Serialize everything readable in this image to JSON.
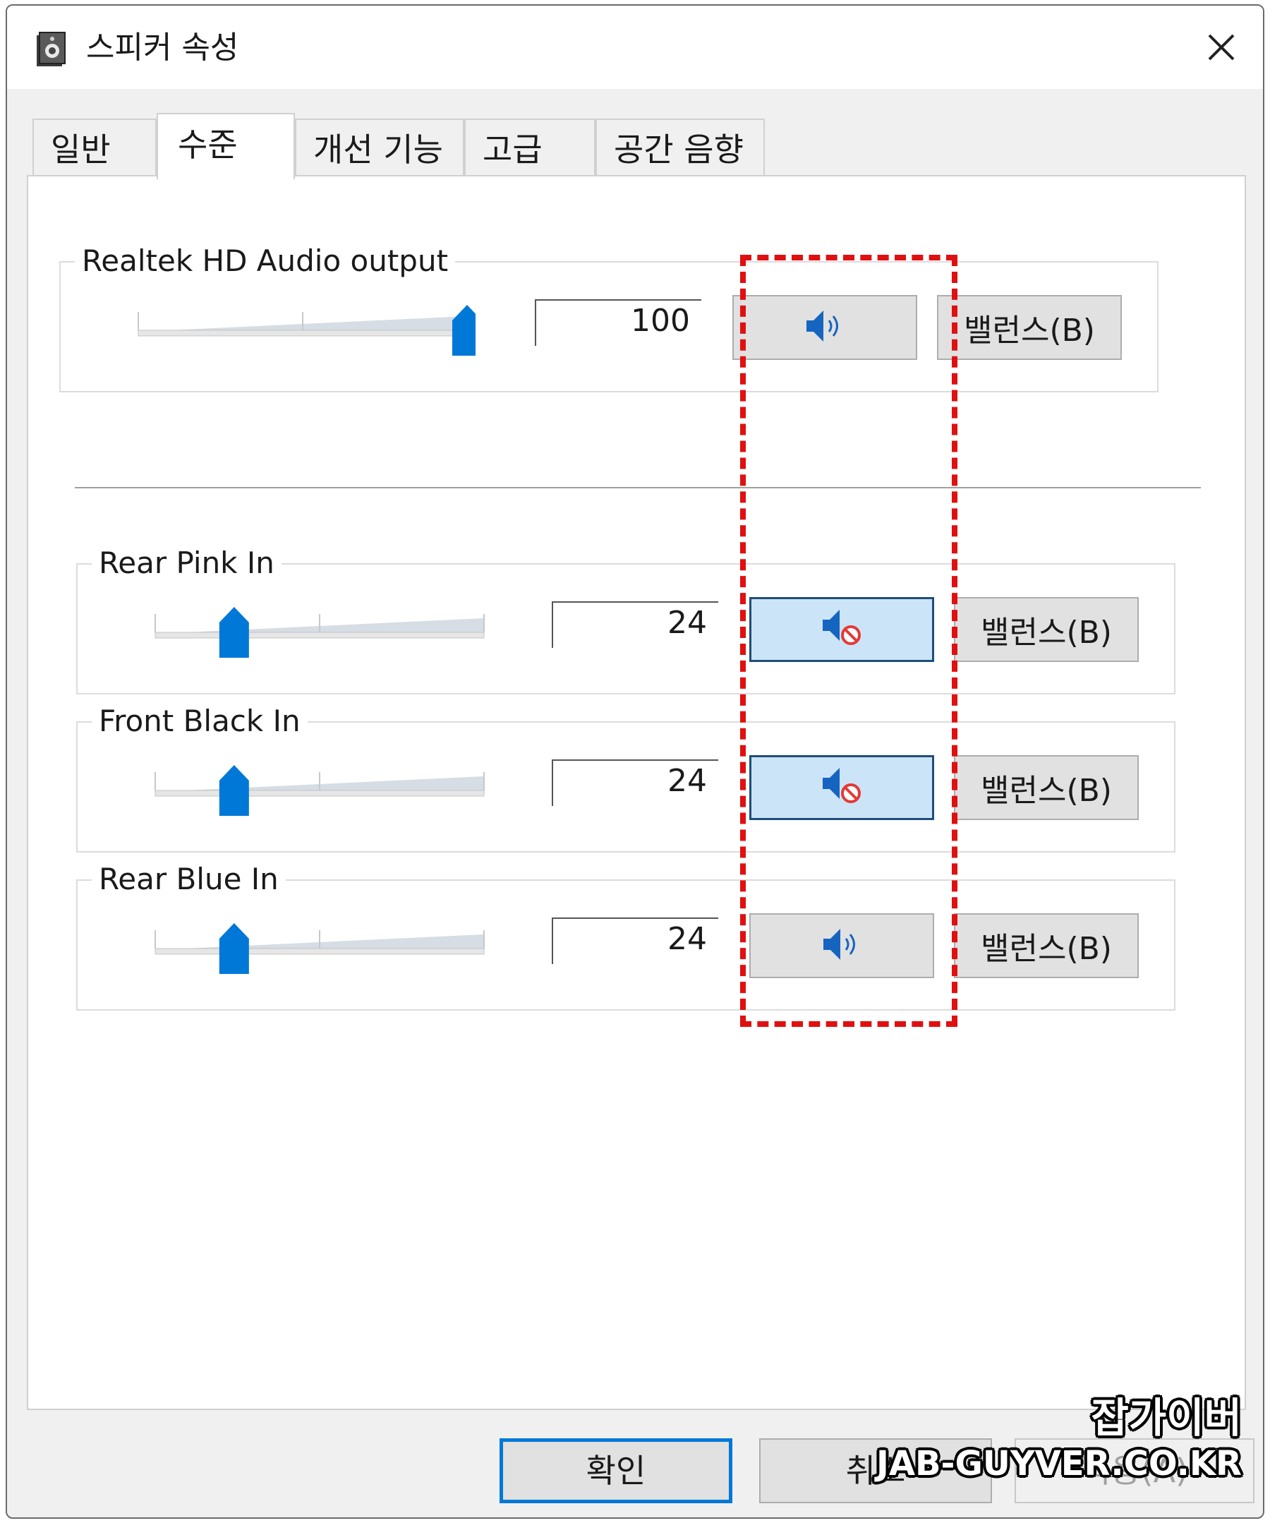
{
  "window": {
    "title": "스피커 속성",
    "icon": "speaker-properties-icon"
  },
  "tabs": [
    {
      "label": "일반",
      "active": false
    },
    {
      "label": "수준",
      "active": true
    },
    {
      "label": "개선 기능",
      "active": false
    },
    {
      "label": "고급",
      "active": false
    },
    {
      "label": "공간 음향",
      "active": false
    }
  ],
  "channels": [
    {
      "name": "Realtek HD Audio output",
      "value": "100",
      "level_percent": 100,
      "muted": false,
      "mute_icon": "speaker-icon",
      "balance_label": "밸런스(B)"
    },
    {
      "name": "Rear Pink In",
      "value": "24",
      "level_percent": 24,
      "muted": true,
      "mute_icon": "speaker-muted-icon",
      "balance_label": "밸런스(B)"
    },
    {
      "name": "Front Black In",
      "value": "24",
      "level_percent": 24,
      "muted": true,
      "mute_icon": "speaker-muted-icon",
      "balance_label": "밸런스(B)"
    },
    {
      "name": "Rear Blue In",
      "value": "24",
      "level_percent": 24,
      "muted": false,
      "mute_icon": "speaker-icon",
      "balance_label": "밸런스(B)"
    }
  ],
  "buttons": {
    "ok": "확인",
    "cancel": "취소",
    "apply": "적용(A)"
  },
  "colors": {
    "accent": "#0078d7",
    "highlight": "#e01010",
    "muted_bg": "#cce4f7"
  },
  "watermark": {
    "line1": "잡가이버",
    "line2": "JAB-GUYVER.CO.KR"
  }
}
